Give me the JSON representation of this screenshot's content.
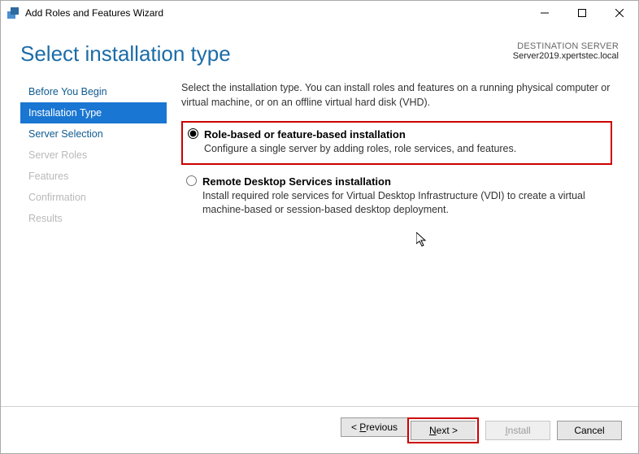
{
  "window": {
    "title": "Add Roles and Features Wizard"
  },
  "header": {
    "page_title": "Select installation type",
    "destination_label": "DESTINATION SERVER",
    "destination_server": "Server2019.xpertstec.local"
  },
  "sidebar": {
    "items": [
      {
        "label": "Before You Begin",
        "state": "enabled"
      },
      {
        "label": "Installation Type",
        "state": "selected"
      },
      {
        "label": "Server Selection",
        "state": "enabled"
      },
      {
        "label": "Server Roles",
        "state": "disabled"
      },
      {
        "label": "Features",
        "state": "disabled"
      },
      {
        "label": "Confirmation",
        "state": "disabled"
      },
      {
        "label": "Results",
        "state": "disabled"
      }
    ]
  },
  "content": {
    "intro": "Select the installation type. You can install roles and features on a running physical computer or virtual machine, or on an offline virtual hard disk (VHD).",
    "options": [
      {
        "title": "Role-based or feature-based installation",
        "desc": "Configure a single server by adding roles, role services, and features.",
        "selected": true,
        "highlighted": true
      },
      {
        "title": "Remote Desktop Services installation",
        "desc": "Install required role services for Virtual Desktop Infrastructure (VDI) to create a virtual machine-based or session-based desktop deployment.",
        "selected": false,
        "highlighted": false
      }
    ]
  },
  "footer": {
    "previous": "< Previous",
    "next": "Next >",
    "install": "Install",
    "cancel": "Cancel"
  }
}
